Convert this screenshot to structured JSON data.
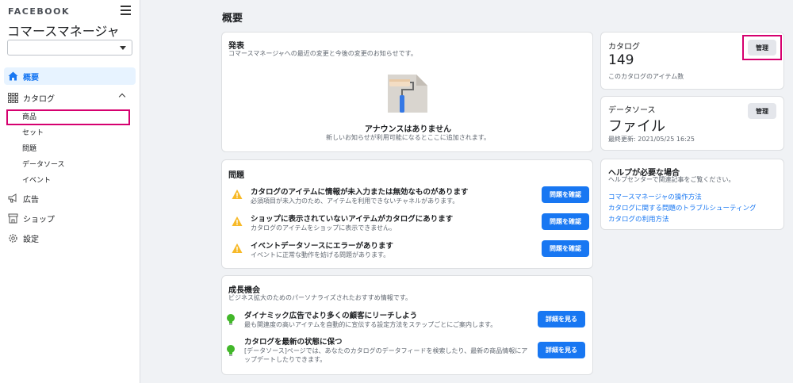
{
  "sidebar": {
    "brand": "FACEBOOK",
    "app_title": "コマースマネージャ",
    "account_select_value": "",
    "overview": "概要",
    "catalog": "カタログ",
    "catalog_items": [
      "商品",
      "セット",
      "問題",
      "データソース",
      "イベント"
    ],
    "ads": "広告",
    "shop": "ショップ",
    "settings": "設定"
  },
  "main": {
    "title": "概要",
    "announcements": {
      "title": "発表",
      "subtitle": "コマースマネージャへの最近の変更と今後の変更のお知らせです。",
      "empty_title": "アナウンスはありません",
      "empty_subtitle": "新しいお知らせが利用可能になるとここに追加されます。"
    },
    "issues": {
      "title": "問題",
      "items": [
        {
          "title": "カタログのアイテムに情報が未入力または無効なものがあります",
          "subtitle": "必須項目が未入力のため、アイテムを利用できないチャネルがあります。",
          "button": "問題を確認"
        },
        {
          "title": "ショップに表示されていないアイテムがカタログにあります",
          "subtitle": "カタログのアイテムをショップに表示できません。",
          "button": "問題を確認"
        },
        {
          "title": "イベントデータソースにエラーがあります",
          "subtitle": "イベントに正常な動作を妨げる問題があります。",
          "button": "問題を確認"
        }
      ]
    },
    "growth": {
      "title": "成長機会",
      "subtitle": "ビジネス拡大のためのパーソナライズされたおすすめ情報です。",
      "items": [
        {
          "title": "ダイナミック広告でより多くの顧客にリーチしよう",
          "desc": "最も関連度の高いアイテムを自動的に宣伝する設定方法をステップごとにご案内します。",
          "button": "詳細を見る"
        },
        {
          "title": "カタログを最新の状態に保つ",
          "desc": "[データソース]ページでは、あなたのカタログのデータフィードを検索したり、最新の商品情報にアップデートしたりできます。",
          "button": "詳細を見る"
        }
      ]
    }
  },
  "right": {
    "catalog": {
      "label": "カタログ",
      "count": "149",
      "sub": "このカタログのアイテム数",
      "button": "管理"
    },
    "datasource": {
      "label": "データソース",
      "value": "ファイル",
      "sub": "最終更新: 2021/05/25 16:25",
      "button": "管理"
    },
    "help": {
      "title": "ヘルプが必要な場合",
      "subtitle": "ヘルプセンターで関連記事をご覧ください。",
      "links": [
        "コマースマネージャの操作方法",
        "カタログに関する問題のトラブルシューティング",
        "カタログの利用方法"
      ]
    }
  },
  "colors": {
    "accent": "#1877f2",
    "highlight": "#d6006f",
    "warning": "#f7b928",
    "bulb": "#42b72a"
  }
}
